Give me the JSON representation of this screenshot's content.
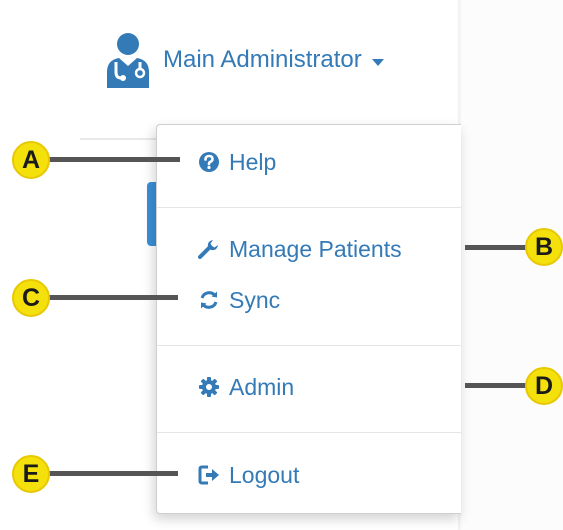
{
  "user": {
    "name": "Main Administrator"
  },
  "menu": {
    "items": [
      {
        "key": "help",
        "label": "Help",
        "icon": "question-circle-icon"
      },
      {
        "key": "manage_patients",
        "label": "Manage Patients",
        "icon": "wrench-icon"
      },
      {
        "key": "sync",
        "label": "Sync",
        "icon": "refresh-icon"
      },
      {
        "key": "admin",
        "label": "Admin",
        "icon": "gear-icon"
      },
      {
        "key": "logout",
        "label": "Logout",
        "icon": "sign-out-icon"
      }
    ]
  },
  "callouts": {
    "a": "A",
    "b": "B",
    "c": "C",
    "d": "D",
    "e": "E"
  },
  "colors": {
    "link": "#337ab7",
    "badge": "#f4e10c",
    "leader": "#555555",
    "accent_tab": "#3a8fd6"
  }
}
